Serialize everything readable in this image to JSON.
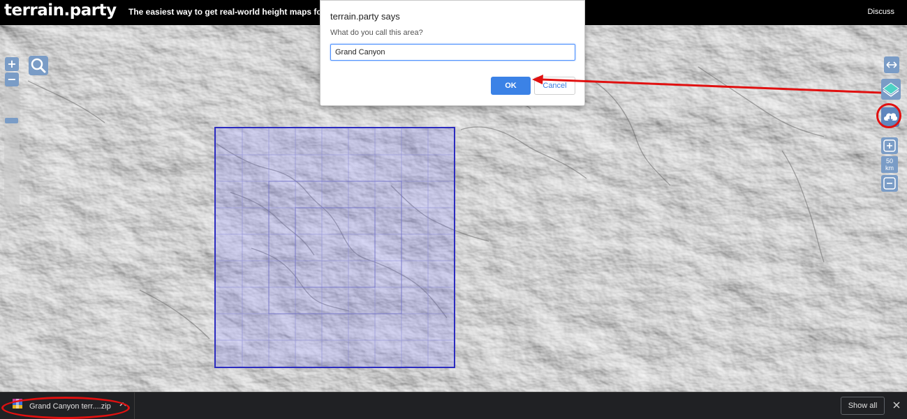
{
  "header": {
    "brand": "terrain.party",
    "tagline": "The easiest way to get real-world height maps for Cities:",
    "discuss_label": "Discuss"
  },
  "map": {
    "zoom_in_label": "+",
    "zoom_out_label": "−",
    "scale_text": "50 km",
    "scale_value": "50",
    "scale_unit": "km",
    "selection_color": "#2b2bbf"
  },
  "dialog": {
    "title": "terrain.party says",
    "message": "What do you call this area?",
    "input_value": "Grand Canyon",
    "ok_label": "OK",
    "cancel_label": "Cancel"
  },
  "downloads": {
    "filename": "Grand Canyon terr....zip",
    "show_all_label": "Show all"
  },
  "colors": {
    "accent": "#3b82e6",
    "control": "#7a9cc6",
    "annotation": "#e01010"
  },
  "icons": {
    "search": "search-icon",
    "expand": "expand-arrows-icon",
    "layers": "layers-icon",
    "download": "cloud-download-icon",
    "scale_zoom_in": "plus-box-icon",
    "scale_zoom_out": "minus-box-icon",
    "file": "archive-file-icon",
    "chevron": "chevron-up-icon",
    "close": "close-icon"
  }
}
